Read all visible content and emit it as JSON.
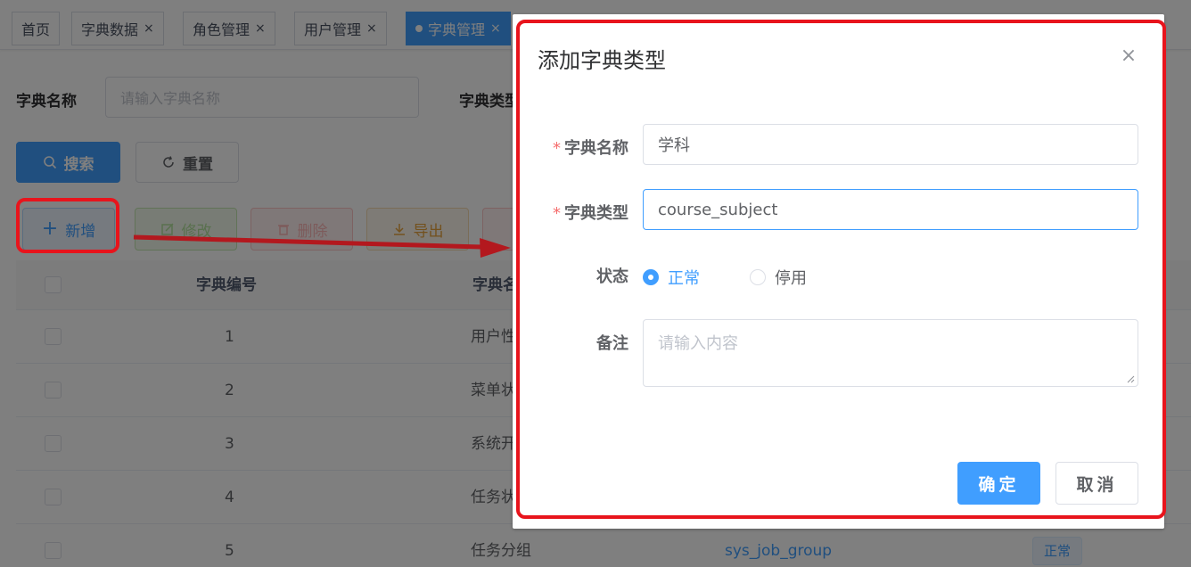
{
  "tags": [
    {
      "label": "首页",
      "closable": false
    },
    {
      "label": "字典数据",
      "closable": true
    },
    {
      "label": "角色管理",
      "closable": true
    },
    {
      "label": "用户管理",
      "closable": true
    },
    {
      "label": "字典管理",
      "closable": true,
      "active": true
    }
  ],
  "tag_close_glyph": "×",
  "query": {
    "name_label": "字典名称",
    "name_placeholder": "请输入字典名称",
    "type_label": "字典类型"
  },
  "buttons": {
    "search": "搜索",
    "reset": "重置",
    "add": "新增",
    "edit": "修改",
    "delete": "删除",
    "export": "导出"
  },
  "table": {
    "headers": [
      "字典编号",
      "字典名称"
    ],
    "rows": [
      {
        "id": "1",
        "name": "用户性别"
      },
      {
        "id": "2",
        "name": "菜单状态"
      },
      {
        "id": "3",
        "name": "系统开关"
      },
      {
        "id": "4",
        "name": "任务状态"
      },
      {
        "id": "5",
        "name": "任务分组",
        "type": "sys_job_group",
        "status": "正常"
      }
    ]
  },
  "dialog": {
    "title": "添加字典类型",
    "close_glyph": "×",
    "required_mark": "*",
    "fields": {
      "name_label": "字典名称",
      "name_value": "学科",
      "type_label": "字典类型",
      "type_value": "course_subject",
      "status_label": "状态",
      "status_options": [
        "正常",
        "停用"
      ],
      "status_selected": "正常",
      "remark_label": "备注",
      "remark_placeholder": "请输入内容"
    },
    "confirm": "确定",
    "cancel": "取消"
  },
  "colors": {
    "primary": "#409eff",
    "annotation": "#e8141c"
  }
}
